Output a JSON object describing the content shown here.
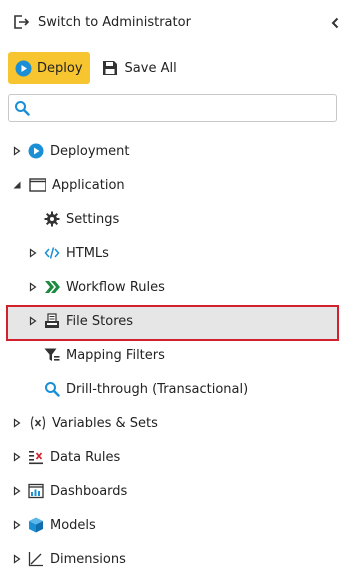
{
  "header": {
    "switch_label": "Switch to Administrator",
    "switch_icon": "switch-role-icon",
    "collapse_icon": "chevron-left-icon"
  },
  "toolbar": {
    "deploy_label": "Deploy",
    "deploy_icon": "deploy-cloud-icon",
    "save_all_label": "Save All",
    "save_icon": "floppy-disk-icon"
  },
  "search": {
    "placeholder": "",
    "value": "",
    "icon": "search-icon"
  },
  "colors": {
    "deploy_background": "#f7c530",
    "selection_border": "#d2202f",
    "selection_background": "#e6e6e6",
    "accent_blue": "#1b8fd6"
  },
  "tree": {
    "items": [
      {
        "label": "Deployment",
        "icon": "deploy-cloud-icon",
        "state": "collapsed"
      },
      {
        "label": "Application",
        "icon": "window-icon",
        "state": "expanded",
        "children": [
          {
            "label": "Settings",
            "icon": "gear-icon"
          },
          {
            "label": "HTMLs",
            "icon": "code-icon",
            "state": "collapsed"
          },
          {
            "label": "Workflow Rules",
            "icon": "workflow-arrows-icon",
            "state": "collapsed"
          },
          {
            "label": "File Stores",
            "icon": "file-store-icon",
            "state": "collapsed",
            "selected": true
          },
          {
            "label": "Mapping Filters",
            "icon": "filter-icon"
          },
          {
            "label": "Drill-through (Transactional)",
            "icon": "magnifier-icon"
          }
        ]
      },
      {
        "label": "Variables & Sets",
        "icon": "variable-x-icon",
        "state": "collapsed"
      },
      {
        "label": "Data Rules",
        "icon": "data-rules-icon",
        "state": "collapsed"
      },
      {
        "label": "Dashboards",
        "icon": "dashboard-icon",
        "state": "collapsed"
      },
      {
        "label": "Models",
        "icon": "cube-icon",
        "state": "collapsed"
      },
      {
        "label": "Dimensions",
        "icon": "axes-icon",
        "state": "collapsed"
      }
    ]
  }
}
